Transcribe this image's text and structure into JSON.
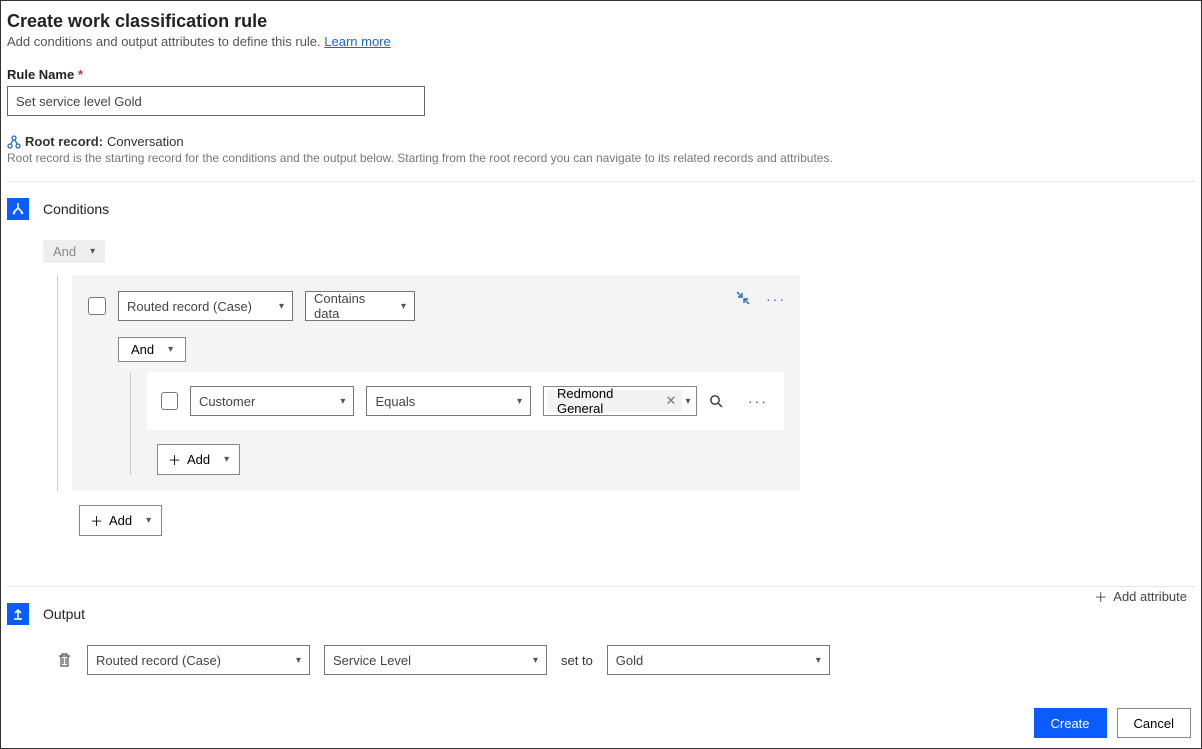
{
  "header": {
    "title": "Create work classification rule",
    "subtitle": "Add conditions and output attributes to define this rule. ",
    "learn_more": "Learn more"
  },
  "rule_name": {
    "label": "Rule Name",
    "value": "Set service level Gold"
  },
  "root_record": {
    "label": "Root record:",
    "value": "Conversation",
    "desc": "Root record is the starting record for the conditions and the output below. Starting from the root record you can navigate to its related records and attributes."
  },
  "conditions": {
    "title": "Conditions",
    "root_op": "And",
    "row1": {
      "entity": "Routed record (Case)",
      "operator": "Contains data"
    },
    "sub_op": "And",
    "row2": {
      "attribute": "Customer",
      "operator": "Equals",
      "value": "Redmond General"
    },
    "add_label": "Add"
  },
  "output": {
    "title": "Output",
    "add_attr": "Add attribute",
    "row": {
      "entity": "Routed record (Case)",
      "attribute": "Service Level",
      "set_to": "set to",
      "value": "Gold"
    }
  },
  "footer": {
    "create": "Create",
    "cancel": "Cancel"
  }
}
